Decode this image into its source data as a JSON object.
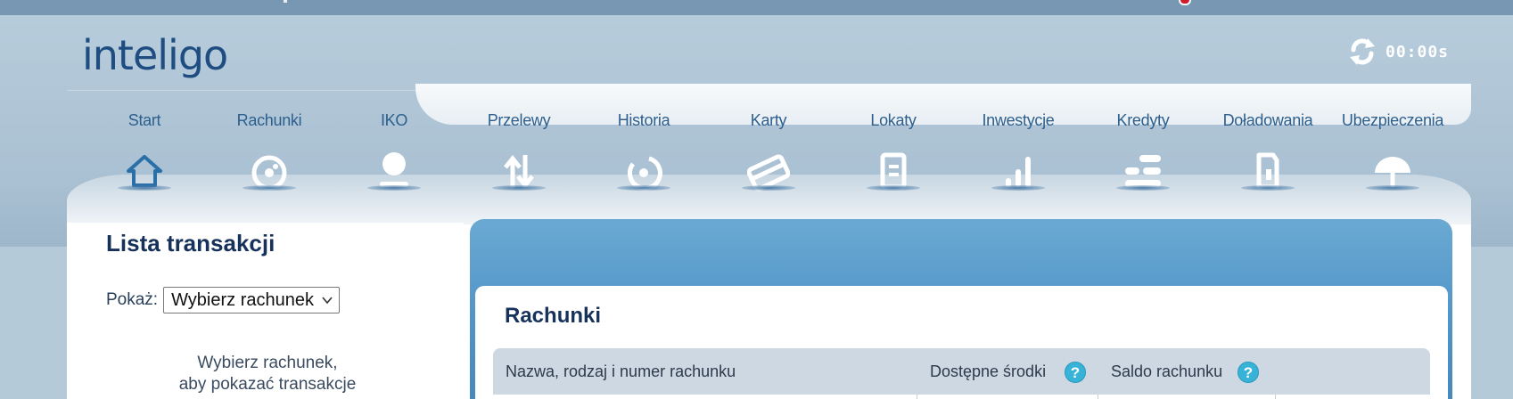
{
  "logo": {
    "text": "inteligo"
  },
  "session": {
    "timer": "00:00s",
    "icon": "refresh-icon"
  },
  "nav": {
    "items": [
      {
        "label": "Start",
        "icon": "home-icon"
      },
      {
        "label": "Rachunki",
        "icon": "accounts-icon"
      },
      {
        "label": "IKO",
        "icon": "iko-icon"
      },
      {
        "label": "Przelewy",
        "icon": "transfer-icon"
      },
      {
        "label": "Historia",
        "icon": "history-icon"
      },
      {
        "label": "Karty",
        "icon": "card-icon"
      },
      {
        "label": "Lokaty",
        "icon": "deposit-icon"
      },
      {
        "label": "Inwestycje",
        "icon": "chart-bars-icon"
      },
      {
        "label": "Kredyty",
        "icon": "credit-icon"
      },
      {
        "label": "Doładowania",
        "icon": "phone-topup-icon"
      },
      {
        "label": "Ubezpieczenia",
        "icon": "umbrella-icon"
      }
    ]
  },
  "transactions": {
    "title": "Lista transakcji",
    "show_label": "Pokaż:",
    "select_value": "Wybierz rachunek",
    "hint_line1": "Wybierz rachunek,",
    "hint_line2": "aby pokazać transakcje"
  },
  "accounts": {
    "title": "Rachunki",
    "columns": [
      {
        "label": "Nazwa, rodzaj i numer rachunku"
      },
      {
        "label": "Dostępne środki",
        "help": "?"
      },
      {
        "label": "Saldo rachunku",
        "help": "?"
      }
    ]
  },
  "colors": {
    "brand": "#1f4d82",
    "accent": "#4f93c7",
    "help": "#38b3d8"
  }
}
